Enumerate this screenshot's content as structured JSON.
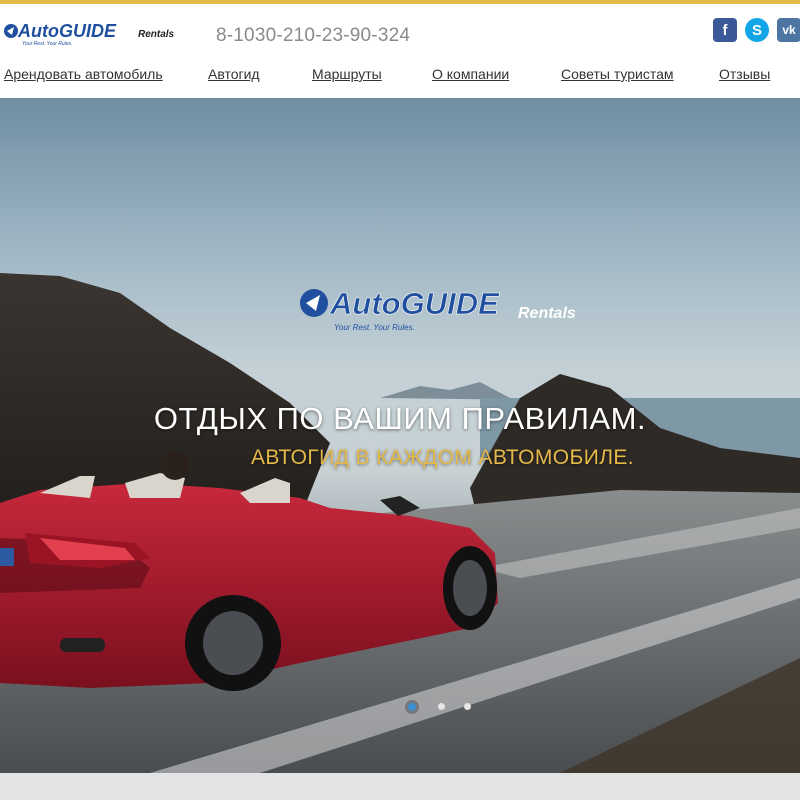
{
  "header": {
    "logo": {
      "brand": "AutoGUIDE",
      "suffix": "Rentals",
      "tagline": "Your Rest. Your Rules."
    },
    "phone": "8-1030-210-23-90-324",
    "social": [
      {
        "name": "facebook-icon",
        "glyph": "f",
        "color": "#3b5998"
      },
      {
        "name": "skype-icon",
        "glyph": "S",
        "color": "#12a5e8"
      },
      {
        "name": "vk-icon",
        "glyph": "vk",
        "color": "#4c75a3"
      }
    ]
  },
  "nav": {
    "items": [
      {
        "label": "Арендовать автомобиль"
      },
      {
        "label": "Автогид"
      },
      {
        "label": "Маршруты"
      },
      {
        "label": "О компании"
      },
      {
        "label": "Советы туристам"
      },
      {
        "label": "Отзывы"
      }
    ]
  },
  "hero": {
    "logo": {
      "brand": "AutoGUIDE",
      "suffix": "Rentals",
      "tagline": "Your Rest. Your Rules."
    },
    "headline": "ОТДЫХ ПО ВАШИМ ПРАВИЛАМ.",
    "subline": "АВТОГИД В КАЖДОМ АВТОМОБИЛЕ.",
    "slides": {
      "count": 3,
      "active": 1
    }
  },
  "colors": {
    "accent": "#e5b84a",
    "brand_blue": "#1f4f9e",
    "top_bar": "#e6b94d",
    "car_red": "#b01c2e"
  }
}
